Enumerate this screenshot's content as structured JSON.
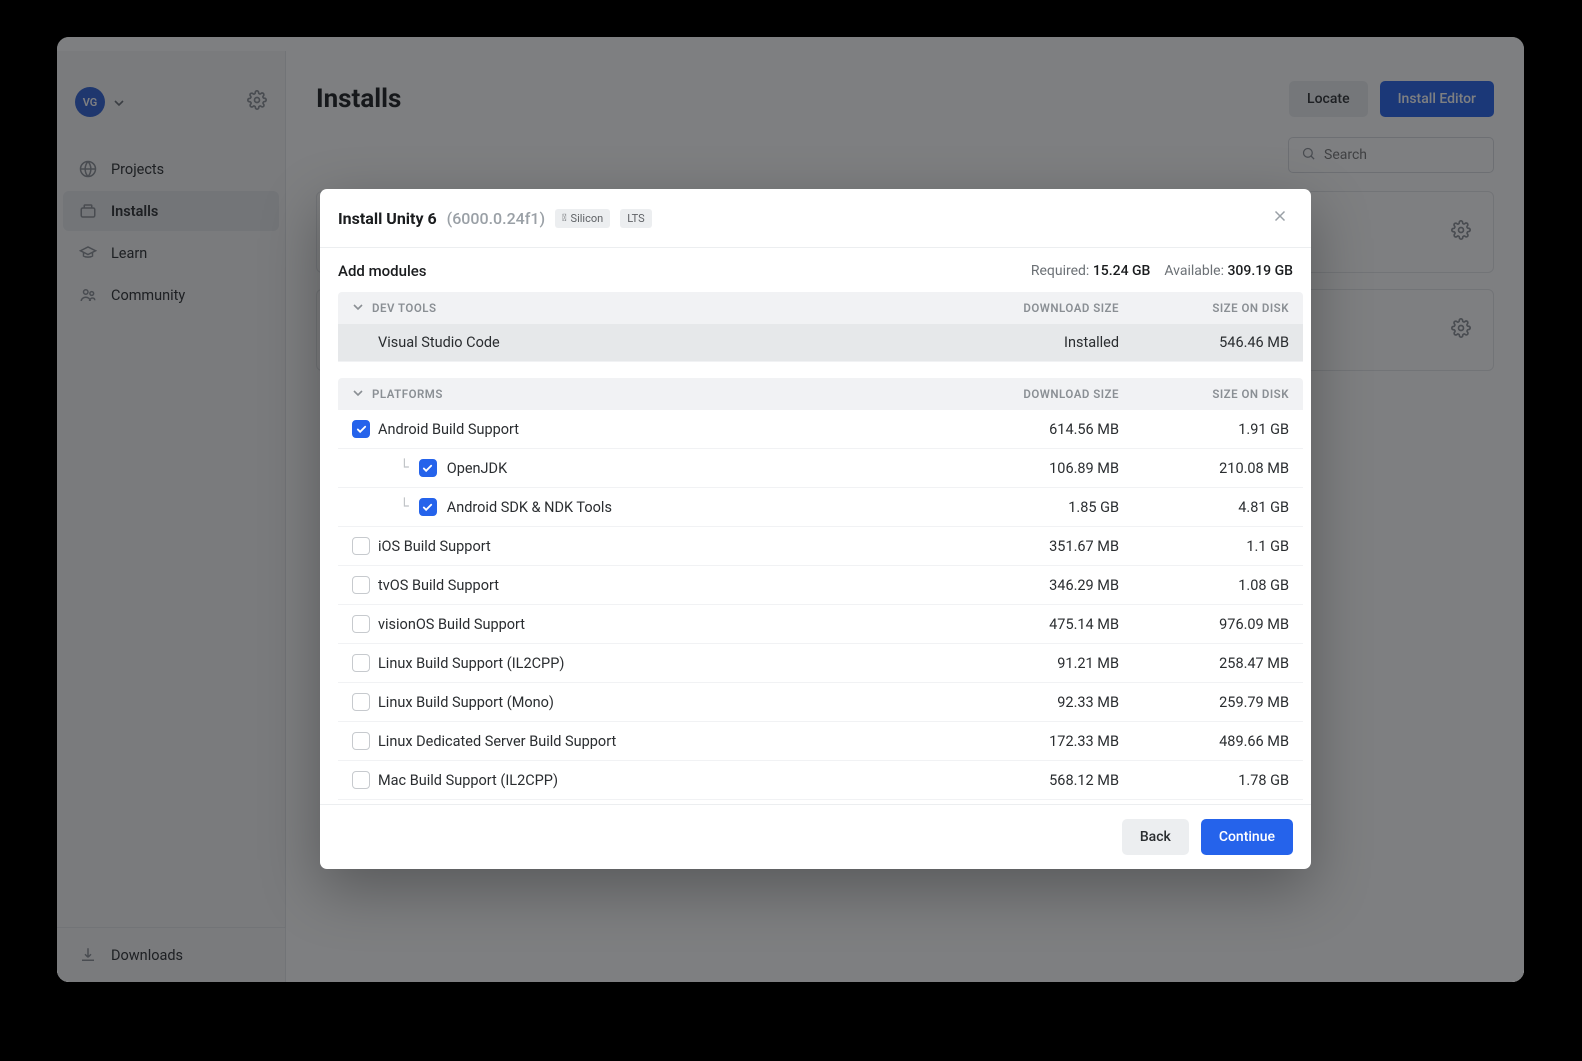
{
  "window": {
    "avatar_initials": "VG"
  },
  "sidebar": {
    "items": [
      {
        "label": "Projects"
      },
      {
        "label": "Installs"
      },
      {
        "label": "Learn"
      },
      {
        "label": "Community"
      }
    ],
    "downloads_label": "Downloads"
  },
  "content": {
    "title": "Installs",
    "locate_label": "Locate",
    "install_editor_label": "Install Editor",
    "search_placeholder": "Search"
  },
  "modal": {
    "title_prefix": "Install Unity 6",
    "version": "(6000.0.24f1)",
    "chip_silicon": "Silicon",
    "chip_lts": "LTS",
    "subheader": "Add modules",
    "required_label": "Required:",
    "required_value": "15.24 GB",
    "available_label": "Available:",
    "available_value": "309.19 GB",
    "col_download": "DOWNLOAD SIZE",
    "col_disk": "SIZE ON DISK",
    "section_devtools": "DEV TOOLS",
    "section_platforms": "PLATFORMS",
    "devtools": [
      {
        "name": "Visual Studio Code",
        "download": "Installed",
        "disk": "546.46 MB",
        "installed": true
      }
    ],
    "platforms": [
      {
        "name": "Android Build Support",
        "download": "614.56 MB",
        "disk": "1.91 GB",
        "checked": true,
        "child": false
      },
      {
        "name": "OpenJDK",
        "download": "106.89 MB",
        "disk": "210.08 MB",
        "checked": true,
        "child": true
      },
      {
        "name": "Android SDK & NDK Tools",
        "download": "1.85 GB",
        "disk": "4.81 GB",
        "checked": true,
        "child": true
      },
      {
        "name": "iOS Build Support",
        "download": "351.67 MB",
        "disk": "1.1 GB",
        "checked": false,
        "child": false
      },
      {
        "name": "tvOS Build Support",
        "download": "346.29 MB",
        "disk": "1.08 GB",
        "checked": false,
        "child": false
      },
      {
        "name": "visionOS Build Support",
        "download": "475.14 MB",
        "disk": "976.09 MB",
        "checked": false,
        "child": false
      },
      {
        "name": "Linux Build Support (IL2CPP)",
        "download": "91.21 MB",
        "disk": "258.47 MB",
        "checked": false,
        "child": false
      },
      {
        "name": "Linux Build Support (Mono)",
        "download": "92.33 MB",
        "disk": "259.79 MB",
        "checked": false,
        "child": false
      },
      {
        "name": "Linux Dedicated Server Build Support",
        "download": "172.33 MB",
        "disk": "489.66 MB",
        "checked": false,
        "child": false
      },
      {
        "name": "Mac Build Support (IL2CPP)",
        "download": "568.12 MB",
        "disk": "1.78 GB",
        "checked": false,
        "child": false
      }
    ],
    "back_label": "Back",
    "continue_label": "Continue"
  }
}
